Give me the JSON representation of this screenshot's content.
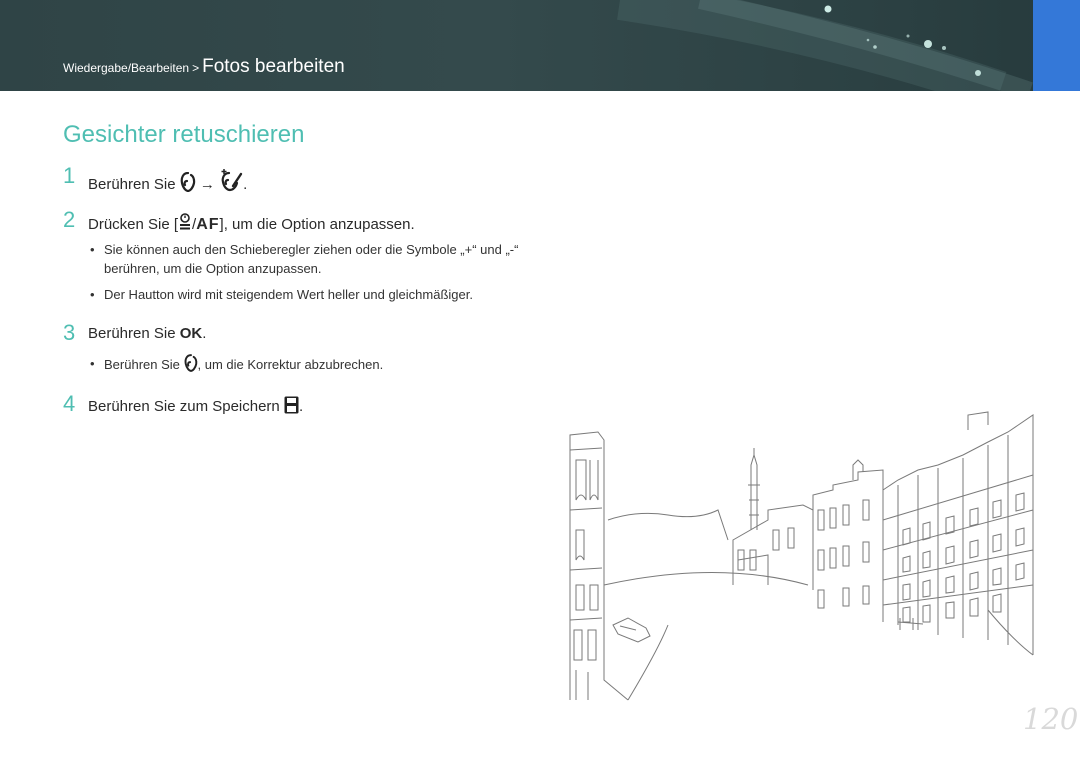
{
  "header": {
    "breadcrumb_parent": "Wiedergabe/Bearbeiten",
    "separator": ">",
    "breadcrumb_current": "Fotos bearbeiten",
    "background_color": "#2f4446",
    "accent_tab_color": "#3478d8"
  },
  "section": {
    "title": "Gesichter retuschieren",
    "title_color": "#4fbeb2"
  },
  "steps": [
    {
      "number": "1",
      "before": "Berühren Sie",
      "arrow": "→",
      "after": ".",
      "icons": [
        "face-icon",
        "face-retouch-icon"
      ]
    },
    {
      "number": "2",
      "before": "Drücken Sie [",
      "slash": "/",
      "after": "], um die Option anzupassen.",
      "icons": [
        "timer-icon",
        "af-icon"
      ],
      "af_text": "AF"
    },
    {
      "number": "3",
      "before": "Berühren Sie",
      "ok": "OK",
      "after": "."
    },
    {
      "number": "4",
      "before": "Berühren Sie zum Speichern",
      "after": ".",
      "icons": [
        "save-icon"
      ]
    }
  ],
  "bullets": {
    "step2": [
      "Sie können auch den Schieberegler ziehen oder die Symbole „+“ und „-“ berühren, um die Option anzupassen.",
      "Der Hautton wird mit steigendem Wert heller und gleichmäßiger."
    ],
    "step3_before": "Berühren Sie",
    "step3_after": ", um die Korrektur abzubrechen.",
    "dot": "•"
  },
  "illustration": {
    "subject": "venice-canal-line-drawing"
  },
  "page_number": "120"
}
